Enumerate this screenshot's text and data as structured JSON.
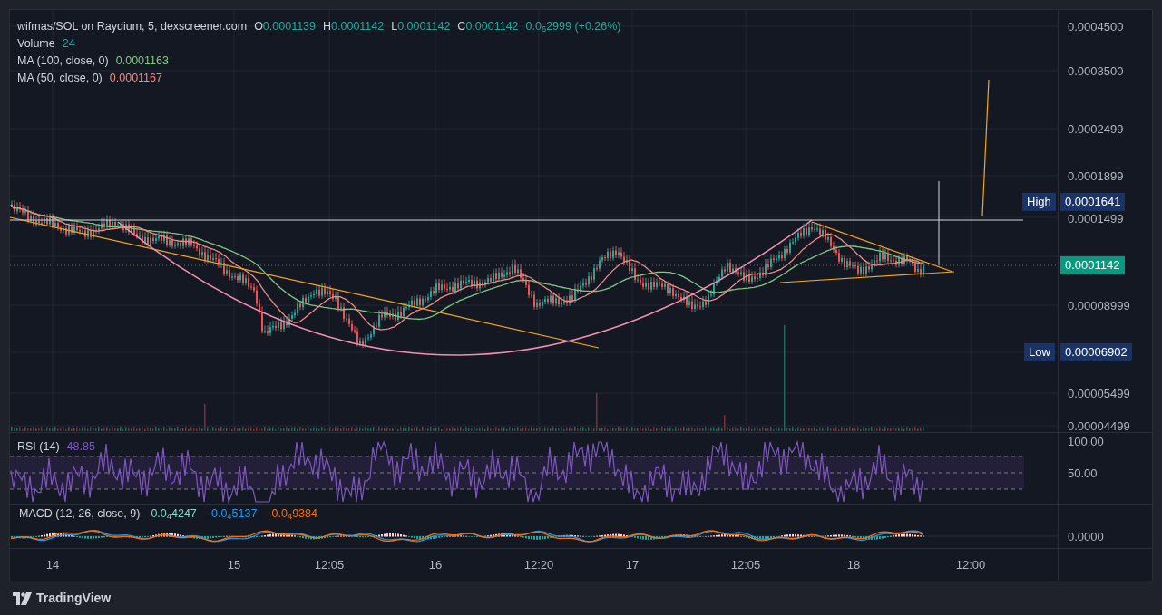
{
  "legend": {
    "symbol": "wifmas/SOL on Raydium, 5, dexscreener.com",
    "ohlc": [
      {
        "label": "O",
        "value": "0.0001139"
      },
      {
        "label": "H",
        "value": "0.0001142"
      },
      {
        "label": "L",
        "value": "0.0001142"
      },
      {
        "label": "C",
        "value": "0.0001142"
      }
    ],
    "change": "0.0$_{6}$2999 (+0.26%)",
    "volume": {
      "label": "Volume",
      "value": "24"
    },
    "indicators": [
      {
        "label": "MA (100, close, 0)",
        "value": "0.0001163",
        "color": "#81c784"
      },
      {
        "label": "MA (50, close, 0)",
        "value": "0.0001167",
        "color": "#f28b82"
      }
    ]
  },
  "price_axis": {
    "ticks": [
      "0.0004500",
      "0.0003500",
      "0.0002499",
      "0.0001899",
      "0.0001499",
      "0.00008999",
      "0.00005499",
      "0.00004499"
    ],
    "high": {
      "label": "High",
      "value": "0.0001641"
    },
    "low": {
      "label": "Low",
      "value": "0.00006902"
    },
    "last_price": "0.0001142"
  },
  "rsi": {
    "label": "RSI (14)",
    "value": "48.85",
    "ticks": [
      "100.00",
      "50.00"
    ]
  },
  "macd": {
    "label": "MACD (12, 26, close, 9)",
    "values": [
      {
        "text": "0.0$_{4}$4247",
        "color": "#7fdbc6"
      },
      {
        "text": "-0.0$_{4}$5137",
        "color": "#2196f3"
      },
      {
        "text": "-0.0$_{4}$9384",
        "color": "#ff6d00"
      }
    ],
    "ticks": [
      "0.0000"
    ]
  },
  "time_axis": [
    "14",
    "15",
    "12:05",
    "16",
    "12:20",
    "17",
    "12:05",
    "18",
    "12:00"
  ],
  "footer": {
    "brand": "TradingView"
  }
}
